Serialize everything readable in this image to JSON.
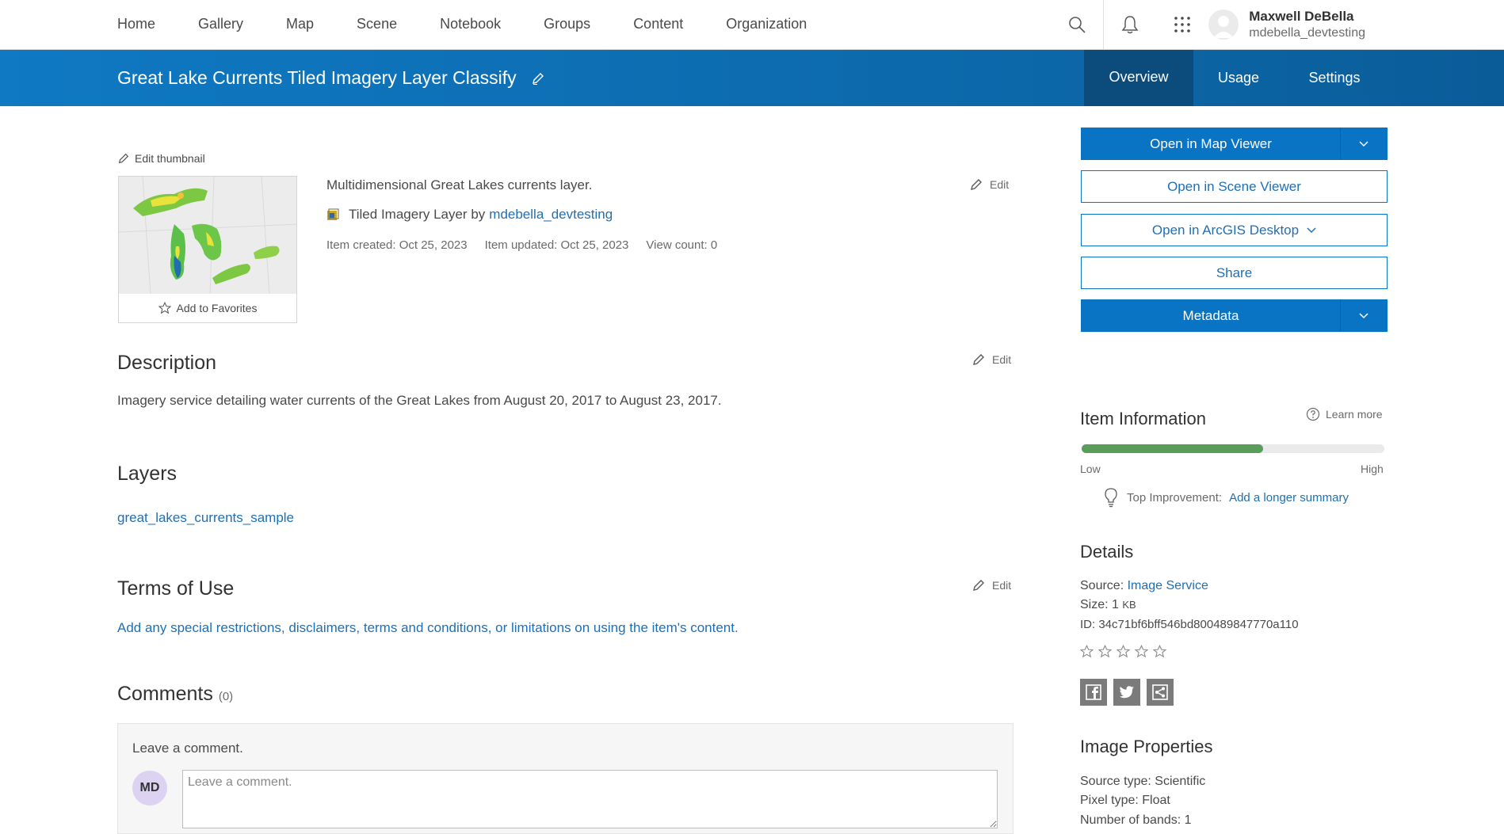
{
  "nav": {
    "links": [
      "Home",
      "Gallery",
      "Map",
      "Scene",
      "Notebook",
      "Groups",
      "Content",
      "Organization"
    ],
    "user_name": "Maxwell DeBella",
    "user_login": "mdebella_devtesting"
  },
  "item": {
    "title": "Great Lake Currents Tiled Imagery Layer Classify",
    "tabs": [
      "Overview",
      "Usage",
      "Settings"
    ],
    "active_tab": "Overview",
    "edit_thumbnail": "Edit thumbnail",
    "add_to_favorites": "Add to Favorites",
    "summary": "Multidimensional Great Lakes currents layer.",
    "type_text": "Tiled Imagery Layer by",
    "owner": "mdebella_devtesting",
    "created": "Item created: Oct 25, 2023",
    "updated": "Item updated: Oct 25, 2023",
    "view_count": "View count: 0",
    "edit_label": "Edit"
  },
  "description": {
    "heading": "Description",
    "text": "Imagery service detailing water currents of the Great Lakes from August 20, 2017 to August 23, 2017."
  },
  "layers": {
    "heading": "Layers",
    "items": [
      "great_lakes_currents_sample"
    ]
  },
  "terms": {
    "heading": "Terms of Use",
    "placeholder_link": "Add any special restrictions, disclaimers, terms and conditions, or limitations on using the item's content."
  },
  "comments": {
    "heading": "Comments",
    "count": "(0)",
    "label": "Leave a comment.",
    "avatar_initials": "MD",
    "placeholder": "Leave a comment."
  },
  "actions": {
    "open_map_viewer": "Open in Map Viewer",
    "open_scene_viewer": "Open in Scene Viewer",
    "open_arcgis_desktop": "Open in ArcGIS Desktop",
    "share": "Share",
    "metadata": "Metadata"
  },
  "item_information": {
    "heading": "Item Information",
    "learn_more": "Learn more",
    "score_fraction": 0.6,
    "low": "Low",
    "high": "High",
    "top_improvement_label": "Top Improvement:",
    "top_improvement_link": "Add a longer summary"
  },
  "details": {
    "heading": "Details",
    "source_label": "Source:",
    "source_value": "Image Service",
    "size_label": "Size: 1",
    "size_unit": "KB",
    "id": "ID: 34c71bf6bff546bd800489847770a110",
    "rating": 0,
    "rating_max": 5
  },
  "image_properties": {
    "heading": "Image Properties",
    "source_type": "Source type: Scientific",
    "pixel_type": "Pixel type: Float",
    "bands": "Number of bands: 1"
  },
  "colors": {
    "brand_blue": "#0a74c4",
    "link_blue": "#1f6fb4",
    "meter_green": "#5a9c5a"
  }
}
